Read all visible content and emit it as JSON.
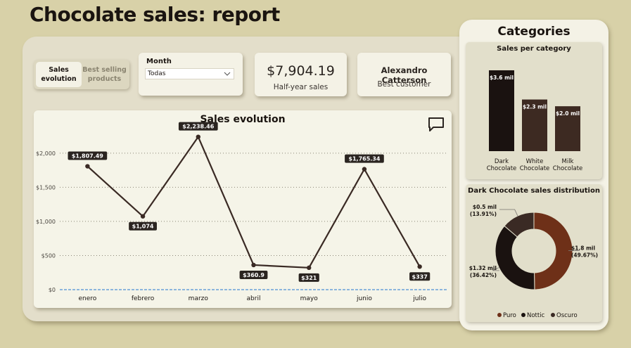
{
  "title": "Chocolate sales: report",
  "tabs": [
    {
      "label": "Sales evolution",
      "active": true
    },
    {
      "label": "Best selling products",
      "active": false
    }
  ],
  "month_filter": {
    "label": "Month",
    "value": "Todas"
  },
  "kpis": {
    "sales_value": "$7,904.19",
    "sales_label": "Half-year sales",
    "customer_value": "Alexandro Catterson",
    "customer_label": "Best customer"
  },
  "categories_panel": {
    "title": "Categories",
    "bar_title": "Sales per category",
    "donut_title": "Dark Chocolate sales distribution"
  },
  "colors": {
    "line": "#3a2a24",
    "bar_dark": "#1a1210",
    "bar_white": "#3d2a22",
    "bar_milk": "#3d2a22",
    "puro": "#6e3018",
    "nottic": "#1a1210",
    "oscuro": "#3a2a24",
    "accent_dash": "#6aa0d8"
  },
  "chart_data": [
    {
      "type": "line",
      "title": "Sales evolution",
      "categories": [
        "enero",
        "febrero",
        "marzo",
        "abril",
        "mayo",
        "junio",
        "julio"
      ],
      "values": [
        1807.49,
        1074,
        2238.46,
        360.9,
        321,
        1765.34,
        337
      ],
      "data_labels": [
        "$1,807.49",
        "$1,074",
        "$2,238.46",
        "$360.9",
        "$321",
        "$1,765.34",
        "$337"
      ],
      "y_ticks": [
        0,
        500,
        1000,
        1500,
        2000
      ],
      "y_tick_labels": [
        "$0",
        "$500",
        "$1,000",
        "$1,500",
        "$2,000"
      ],
      "ylim": [
        0,
        2400
      ],
      "grid": true
    },
    {
      "type": "bar",
      "title": "Sales per category",
      "categories": [
        "Dark Chocolate",
        "White Chocolate",
        "Milk Chocolate"
      ],
      "category_lines": [
        [
          "Dark",
          "Chocolate"
        ],
        [
          "White",
          "Chocolate"
        ],
        [
          "Milk",
          "Chocolate"
        ]
      ],
      "values": [
        3.6,
        2.3,
        2.0
      ],
      "data_labels": [
        "$3.6 mil",
        "$2.3 mil",
        "$2.0 mil"
      ]
    },
    {
      "type": "pie",
      "title": "Dark Chocolate sales distribution",
      "donut": true,
      "slices": [
        {
          "name": "Puro",
          "value": 1.8,
          "label": "$1.8 mil",
          "pct": "(49.67%)"
        },
        {
          "name": "Nottic",
          "value": 1.32,
          "label": "$1.32 mil",
          "pct": "(36.42%)"
        },
        {
          "name": "Oscuro",
          "value": 0.5,
          "label": "$0.5 mil",
          "pct": "(13.91%)"
        }
      ],
      "legend_position": "bottom"
    }
  ]
}
